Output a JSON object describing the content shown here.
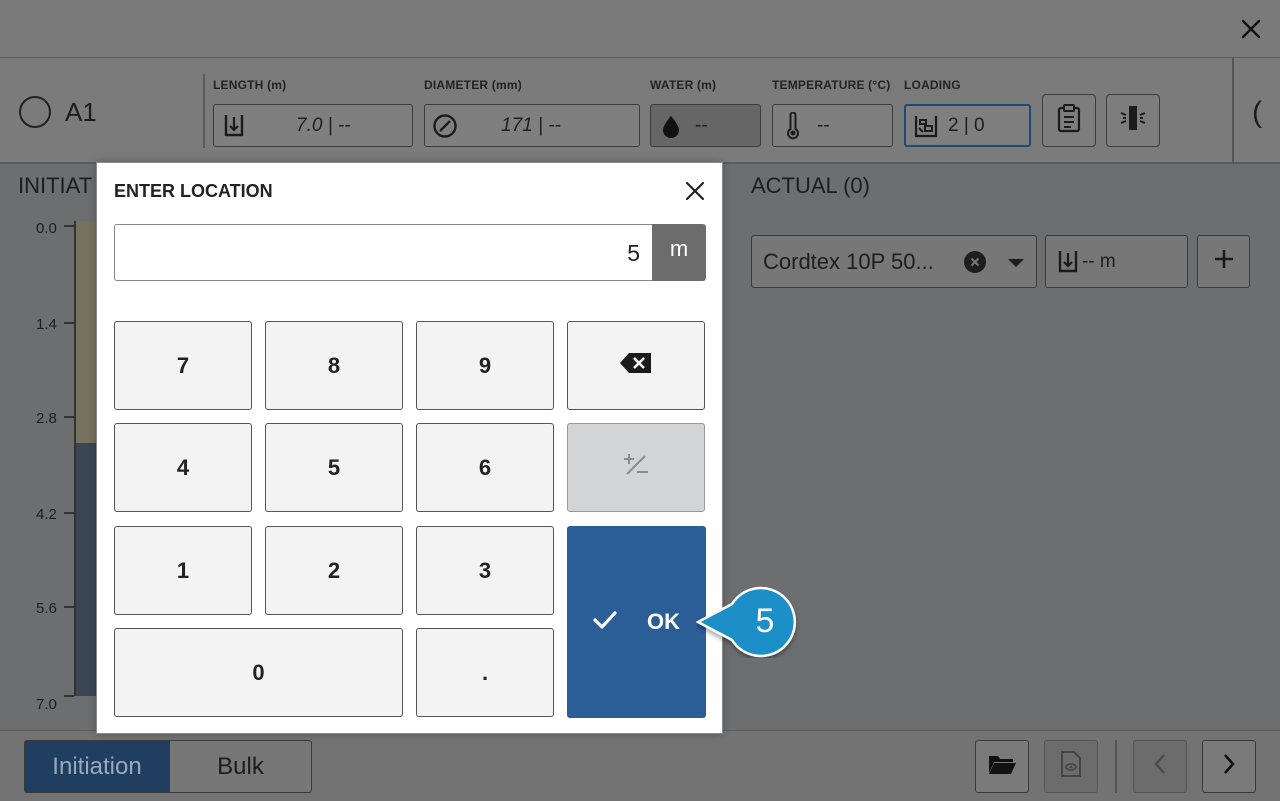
{
  "hole": {
    "name": "A1"
  },
  "fields": {
    "length": {
      "label": "LENGTH (m)",
      "value": "7.0 | --"
    },
    "diameter": {
      "label": "DIAMETER (mm)",
      "value": "171 | --"
    },
    "water": {
      "label": "WATER (m)",
      "value": "--"
    },
    "temperature": {
      "label": "TEMPERATURE (°C)",
      "value": "--"
    },
    "loading": {
      "label": "LOADING",
      "value": "2 | 0"
    }
  },
  "left_panel": {
    "title": "INITIAT",
    "axis_ticks": [
      "0.0",
      "1.4",
      "2.8",
      "4.2",
      "5.6",
      "7.0"
    ]
  },
  "right_panel": {
    "title": "ACTUAL (0)",
    "product_value": "Cordtex 10P 50...",
    "depth_value": "-- m"
  },
  "footer": {
    "tab_initiation": "Initiation",
    "tab_bulk": "Bulk"
  },
  "modal": {
    "title": "ENTER LOCATION",
    "input_value": "5",
    "unit": "m",
    "keys": {
      "k7": "7",
      "k8": "8",
      "k9": "9",
      "k4": "4",
      "k5": "5",
      "k6": "6",
      "k1": "1",
      "k2": "2",
      "k3": "3",
      "k0": "0",
      "dot": "."
    },
    "ok_label": "OK"
  },
  "callout": {
    "number": "5"
  },
  "colors": {
    "accent_blue": "#2b5d97",
    "callout_blue": "#1f8fc8",
    "active_tab": "#203e5f"
  }
}
